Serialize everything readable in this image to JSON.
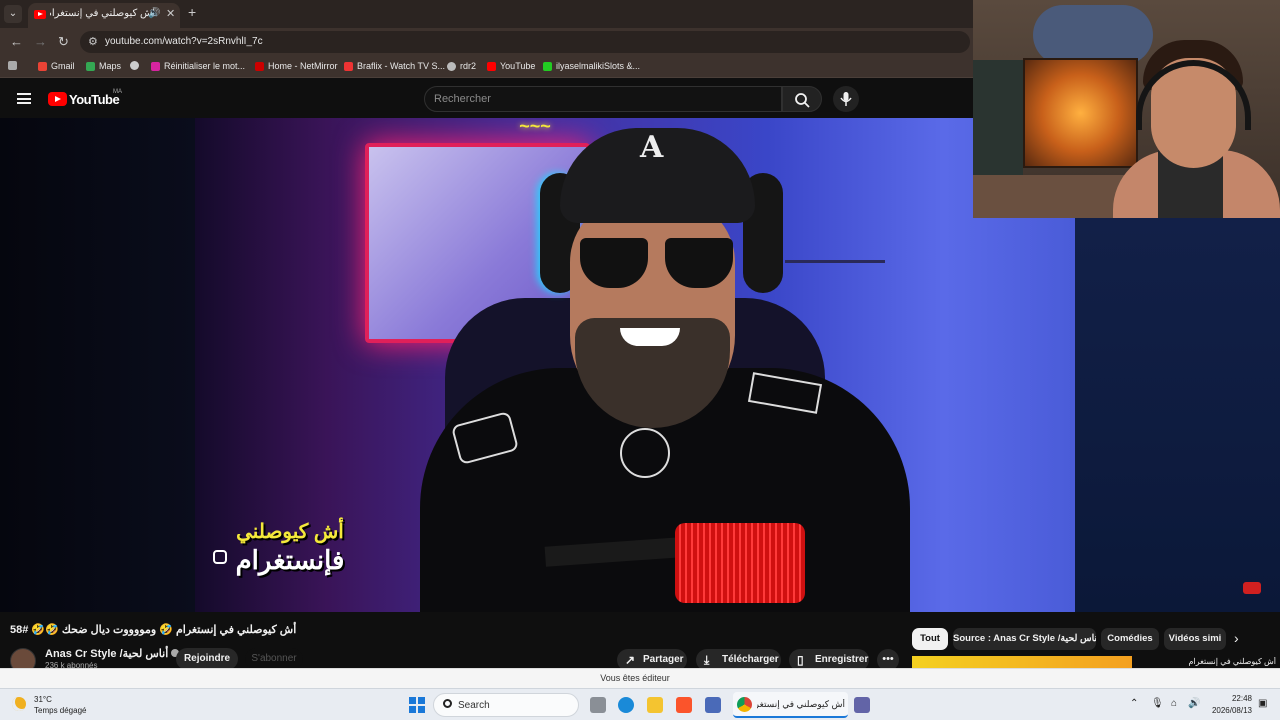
{
  "browser": {
    "tab_title": "أش كيوصلني في إنستغرام",
    "url": "youtube.com/watch?v=2sRnvhlI_7c",
    "bookmarks": [
      "Gmail",
      "Maps",
      "Réinitialiser le mot...",
      "Home - NetMirror",
      "Braflix - Watch TV S...",
      "rdr2",
      "YouTube",
      "ilyaselmalikiSlots &..."
    ]
  },
  "youtube": {
    "logo_text": "YouTube",
    "country_code": "MA",
    "search_placeholder": "Rechercher",
    "video_overlay_line1": "أش كيوصلني",
    "video_overlay_line2": "فإنستغرام",
    "video_title": "أش كيوصلني في إنستغرام 🤣 ومووووت ديال ضحك 🤣🤣 #58",
    "channel_name": "Anas Cr Style /أناس لحية",
    "subscribers": "236 k abonnés",
    "join_label": "Rejoindre",
    "subscribe_label": "S'abonner",
    "share_label": "Partager",
    "download_label": "Télécharger",
    "save_label": "Enregistrer",
    "more_label": "•••",
    "chips": [
      "Tout",
      "Source : Anas Cr Style /أناس لحية",
      "Comédies",
      "Vidéos simi"
    ],
    "next_title": "أش كيوصلني في إنستغرام"
  },
  "editor_banner": "Vous êtes éditeur",
  "taskbar": {
    "weather_temp": "31°C",
    "weather_desc": "Temps dégagé",
    "search_label": "Search",
    "active_window": "أش كيوصلني في إنستغراه",
    "time": "22:48",
    "date": "2026/08/13"
  },
  "colors": {
    "youtube_red": "#ff0000",
    "page_bg": "#0f0f0f",
    "chip_bg": "#272727",
    "windows_accent": "#1a78d8"
  }
}
